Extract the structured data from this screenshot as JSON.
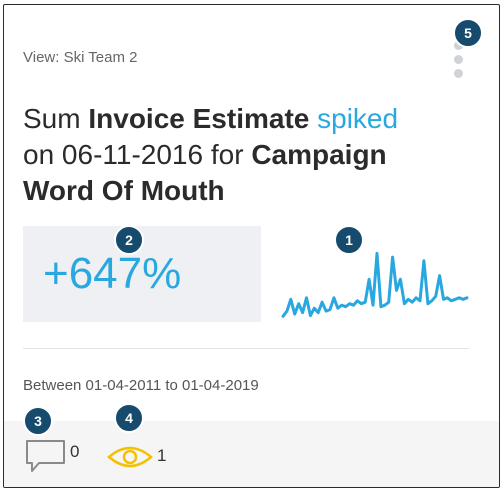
{
  "card": {
    "view_label": "View: Ski Team 2",
    "headline": {
      "prefix": "Sum",
      "measure": "Invoice Estimate",
      "trend": "spiked",
      "date_phrase": "on 06-11-2016 for",
      "dimension": "Campaign",
      "dimension_value": "Word Of Mouth"
    },
    "change_percent": "+647%",
    "date_range": "Between 01-04-2011 to 01-04-2019",
    "comments_count": "0",
    "views_count": "1"
  },
  "annotations": [
    "1",
    "2",
    "3",
    "4",
    "5"
  ],
  "colors": {
    "accent": "#29a8e0",
    "badge": "#164b6e",
    "eye": "#f5c000",
    "text": "#2b2b2b"
  },
  "icons": [
    "kebab-menu-icon",
    "comment-icon",
    "eye-icon"
  ],
  "chart_data": {
    "type": "line",
    "title": "",
    "xlabel": "",
    "ylabel": "",
    "x": [
      0,
      1,
      2,
      3,
      4,
      5,
      6,
      7,
      8,
      9,
      10,
      11,
      12,
      13,
      14,
      15,
      16,
      17,
      18,
      19,
      20,
      21,
      22,
      23,
      24,
      25,
      26,
      27,
      28,
      29,
      30,
      31,
      32,
      33,
      34,
      35,
      36,
      37,
      38,
      39,
      40,
      41,
      42,
      43,
      44,
      45,
      46,
      47
    ],
    "values": [
      0.05,
      0.12,
      0.28,
      0.08,
      0.22,
      0.1,
      0.3,
      0.06,
      0.16,
      0.1,
      0.24,
      0.12,
      0.14,
      0.3,
      0.16,
      0.2,
      0.18,
      0.22,
      0.2,
      0.26,
      0.22,
      0.24,
      0.55,
      0.2,
      0.9,
      0.18,
      0.2,
      0.24,
      0.85,
      0.4,
      0.55,
      0.22,
      0.28,
      0.24,
      0.3,
      0.26,
      0.8,
      0.22,
      0.26,
      0.32,
      0.6,
      0.28,
      0.3,
      0.26,
      0.28,
      0.3,
      0.28,
      0.3
    ]
  }
}
